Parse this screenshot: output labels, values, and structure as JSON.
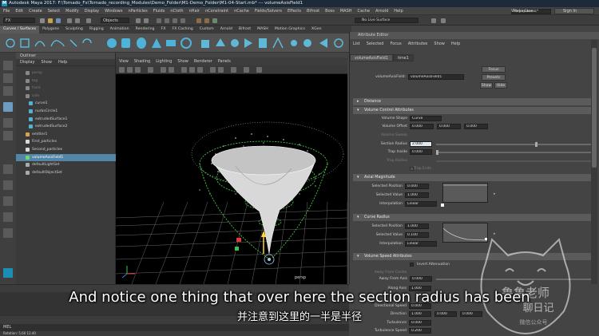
{
  "titlebar": {
    "title": "Autodesk Maya 2017: F:\\Tornado_Fx\\Tornado_recording_Modules\\Demo_Folder\\M1-Demo_Folder\\M1-04-Start.mb*  ---  volumeAxisField1"
  },
  "menubar": {
    "items": [
      "File",
      "Edit",
      "Create",
      "Select",
      "Modify",
      "Display",
      "Windows",
      "nParticles",
      "Fluids",
      "nCloth",
      "nHair",
      "nConstraint",
      "nCache",
      "Fields/Solvers",
      "Effects",
      "Bifrost",
      "Boss",
      "MASH",
      "Cache",
      "Arnold",
      "Help"
    ],
    "workspace_label": "Workspace :",
    "workspace_value": "Maya Classic*",
    "sign_in": "Sign In"
  },
  "statusline": {
    "mode": "FX",
    "objects": "Objects",
    "no_live_surface": "No Live Surface"
  },
  "shelf": {
    "tabs": [
      "Curves / Surfaces",
      "Polygons",
      "Sculpting",
      "Rigging",
      "Animation",
      "Rendering",
      "FX",
      "FX Caching",
      "Custom",
      "Arnold",
      "Bifrost",
      "MASH",
      "Motion Graphics",
      "XGen"
    ],
    "active": "Curves / Surfaces"
  },
  "outliner": {
    "title": "Outliner",
    "menu": [
      "Display",
      "Show",
      "Help"
    ],
    "items": [
      {
        "label": "persp",
        "dim": true
      },
      {
        "label": "top",
        "dim": true
      },
      {
        "label": "front",
        "dim": true
      },
      {
        "label": "side",
        "dim": true
      },
      {
        "label": "curve1",
        "dim": false
      },
      {
        "label": "nurbsCircle1",
        "dim": false
      },
      {
        "label": "extrudedSurface1",
        "dim": false
      },
      {
        "label": "extrudedSurface2",
        "dim": false
      },
      {
        "label": "emitter1",
        "dim": false
      },
      {
        "label": "First_particles",
        "dim": false
      },
      {
        "label": "Second_particles",
        "dim": false
      },
      {
        "label": "volumeAxisField1",
        "dim": false,
        "selected": true
      },
      {
        "label": "defaultLightSet",
        "dim": false
      },
      {
        "label": "defaultObjectSet",
        "dim": false
      }
    ]
  },
  "viewport": {
    "menu": [
      "View",
      "Shading",
      "Lighting",
      "Show",
      "Renderer",
      "Panels"
    ],
    "camera_label": "persp"
  },
  "attribute_editor": {
    "title": "Attribute Editor",
    "menu": [
      "List",
      "Selected",
      "Focus",
      "Attributes",
      "Show",
      "Help"
    ],
    "tabs": [
      "volumeAxisField1",
      "time1"
    ],
    "node_label": "volumeAxisField:",
    "node_value": "volumeAxisField1",
    "buttons": {
      "focus": "Focus",
      "presets": "Presets",
      "show": "Show",
      "hide": "Hide"
    },
    "sections": {
      "distance": "Distance",
      "volume_control": "Volume Control Attributes",
      "axial_magnitude": "Axial Magnitude",
      "curve_radius": "Curve Radius",
      "volume_speed": "Volume Speed Attributes"
    },
    "volume_control": {
      "volume_shape_label": "Volume Shape",
      "volume_shape_value": "Curve",
      "volume_offset_label": "Volume Offset",
      "volume_offset_values": [
        "0.000",
        "0.000",
        "0.000"
      ],
      "volume_sweep_label": "Volume Sweep",
      "section_radius_label": "Section Radius",
      "section_radius_value": "2.000",
      "trap_inside_label": "Trap Inside",
      "trap_inside_value": "0.000",
      "trap_radius_label": "Trap Radius",
      "trap_ends_label": "Trap Ends"
    },
    "axial_magnitude": {
      "selected_position_label": "Selected Position",
      "selected_position_value": "0.000",
      "selected_value_label": "Selected Value",
      "selected_value_value": "1.000",
      "interpolation_label": "Interpolation",
      "interpolation_value": "Linear"
    },
    "curve_radius": {
      "selected_position_label": "Selected Position",
      "selected_position_value": "1.000",
      "selected_value_label": "Selected Value",
      "selected_value_value": "0.100",
      "interpolation_label": "Interpolation",
      "interpolation_value": "Linear"
    },
    "volume_speed": {
      "invert_attenuation_label": "Invert Attenuation",
      "away_from_center_label": "Away From Center",
      "away_from_axis_label": "Away From Axis",
      "away_from_axis_value": "0.000",
      "along_axis_label": "Along Axis",
      "along_axis_value": "1.000",
      "directional_speed_label": "Directional Speed",
      "directional_speed_value": "0.000",
      "direction_label": "Direction",
      "direction_values": [
        "1.000",
        "0.000",
        "0.000"
      ],
      "turbulence_label": "Turbulence",
      "turbulence_value": "0.000",
      "turbulence_speed_label": "Turbulence Speed",
      "turbulence_speed_value": "0.200"
    }
  },
  "bottom": {
    "cmd_label": "MEL",
    "help_text": "Rotation:   5.60   12.40"
  },
  "subtitles": {
    "english": "And notice one thing that over here the section radius has been",
    "chinese": "并注意到这里的一半是半径"
  },
  "watermark": {
    "line1": "鲁鲁老师",
    "line2": "聊日记",
    "line3": "微信公众号"
  },
  "colors": {
    "selection": "#5285a6",
    "maya_blue": "#1a8fb3",
    "field_green": "#4cd94c",
    "particle_white": "#ffffff"
  }
}
